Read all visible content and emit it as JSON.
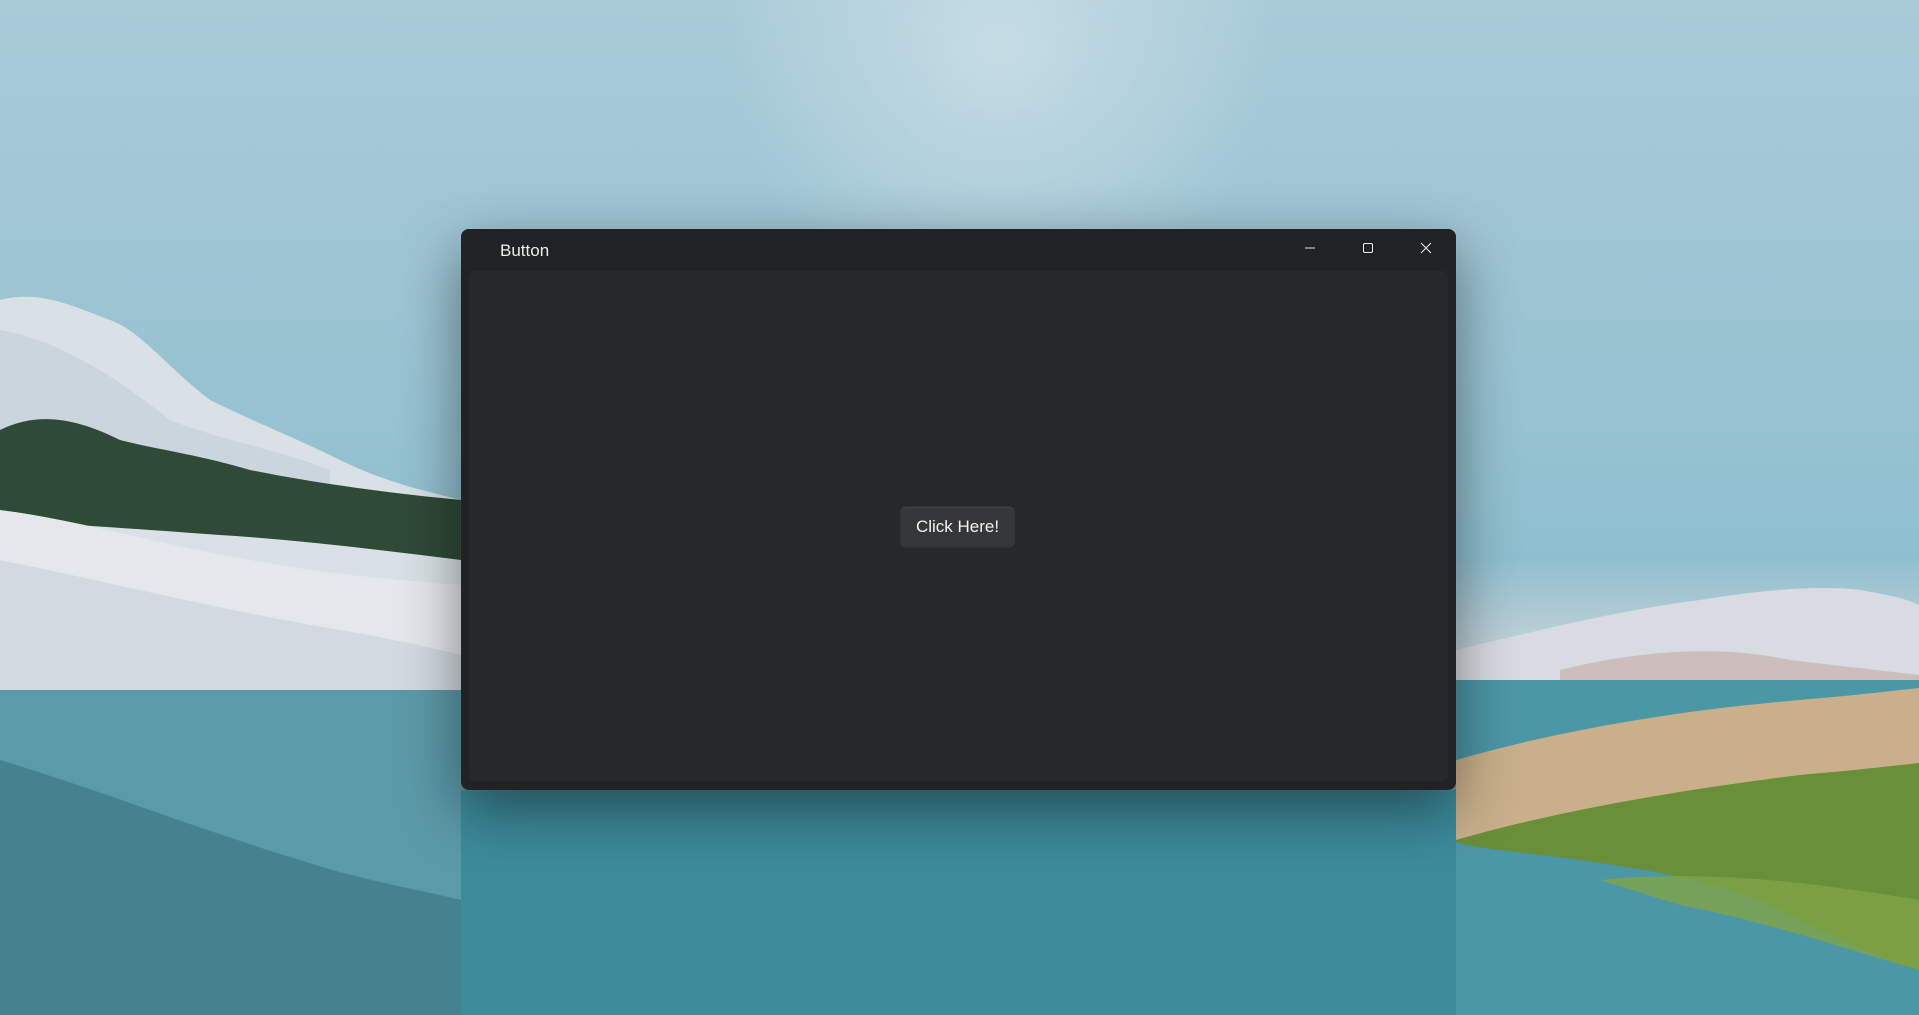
{
  "window": {
    "title": "Button",
    "controls": {
      "minimize_icon": "minimize-icon",
      "maximize_icon": "maximize-icon",
      "close_icon": "close-icon"
    }
  },
  "content": {
    "button_label": "Click Here!"
  },
  "colors": {
    "window_background": "#202223",
    "content_background": "#272829",
    "button_background": "#353637",
    "text": "#f2f2f2"
  }
}
